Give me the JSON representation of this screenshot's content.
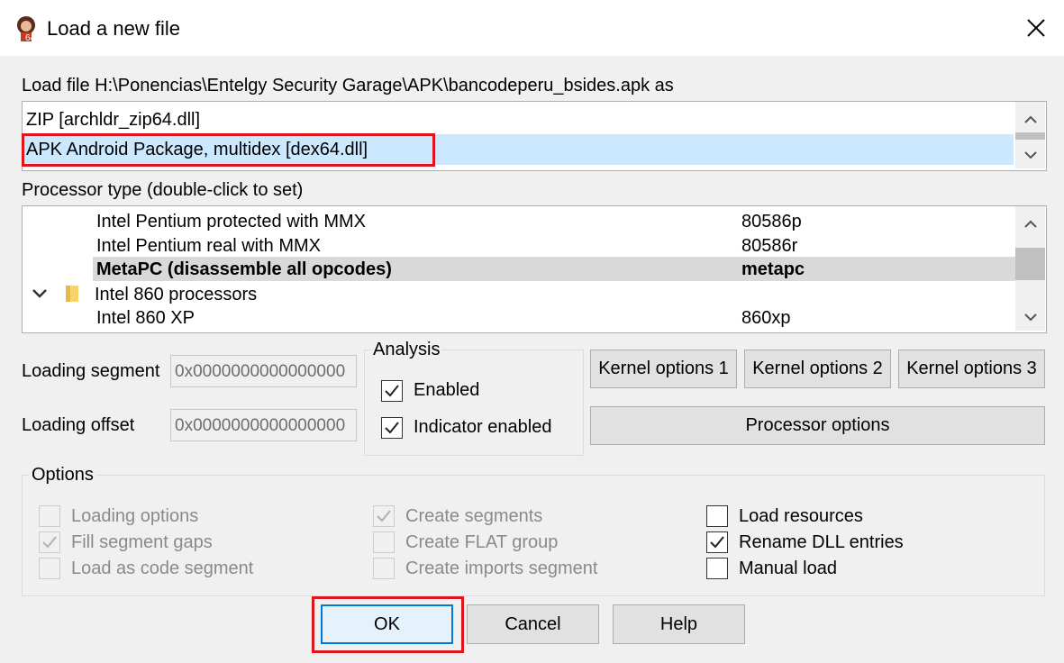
{
  "window": {
    "title": "Load a new file",
    "app_icon": "ida-portrait-icon",
    "close_icon": "close-icon"
  },
  "load_label": "Load file H:\\Ponencias\\Entelgy Security Garage\\APK\\bancodeperu_bsides.apk as",
  "loaders": [
    {
      "label": "ZIP [archldr_zip64.dll]"
    },
    {
      "label": "APK Android Package, multidex [dex64.dll]"
    }
  ],
  "processor_label": "Processor type (double-click to set)",
  "processors": [
    {
      "name": "Intel Pentium protected with MMX",
      "code": "80586p"
    },
    {
      "name": "Intel Pentium real with MMX",
      "code": "80586r"
    },
    {
      "name": "MetaPC (disassemble all opcodes)",
      "code": "metapc"
    },
    {
      "name": "Intel 860 processors",
      "code": ""
    },
    {
      "name": "Intel 860 XP",
      "code": "860xp"
    }
  ],
  "loading_segment": {
    "label": "Loading segment",
    "value": "0x0000000000000000"
  },
  "loading_offset": {
    "label": "Loading offset",
    "value": "0x0000000000000000"
  },
  "analysis": {
    "title": "Analysis",
    "enabled": "Enabled",
    "indicator": "Indicator enabled"
  },
  "buttons": {
    "kernel1": "Kernel options 1",
    "kernel2": "Kernel options 2",
    "kernel3": "Kernel options 3",
    "processor_options": "Processor options",
    "ok": "OK",
    "cancel": "Cancel",
    "help": "Help"
  },
  "options": {
    "title": "Options",
    "loading_options": "Loading options",
    "fill_gaps": "Fill segment gaps",
    "load_code_segment": "Load as code segment",
    "create_segments": "Create segments",
    "create_flat": "Create FLAT group",
    "create_imports": "Create imports segment",
    "load_resources": "Load resources",
    "rename_dll": "Rename DLL entries",
    "manual_load": "Manual load"
  },
  "colors": {
    "selection": "#cce8ff",
    "highlight_row": "#d9d9d9",
    "annotation_red": "#e0141e",
    "folder": "#f8d36a"
  }
}
